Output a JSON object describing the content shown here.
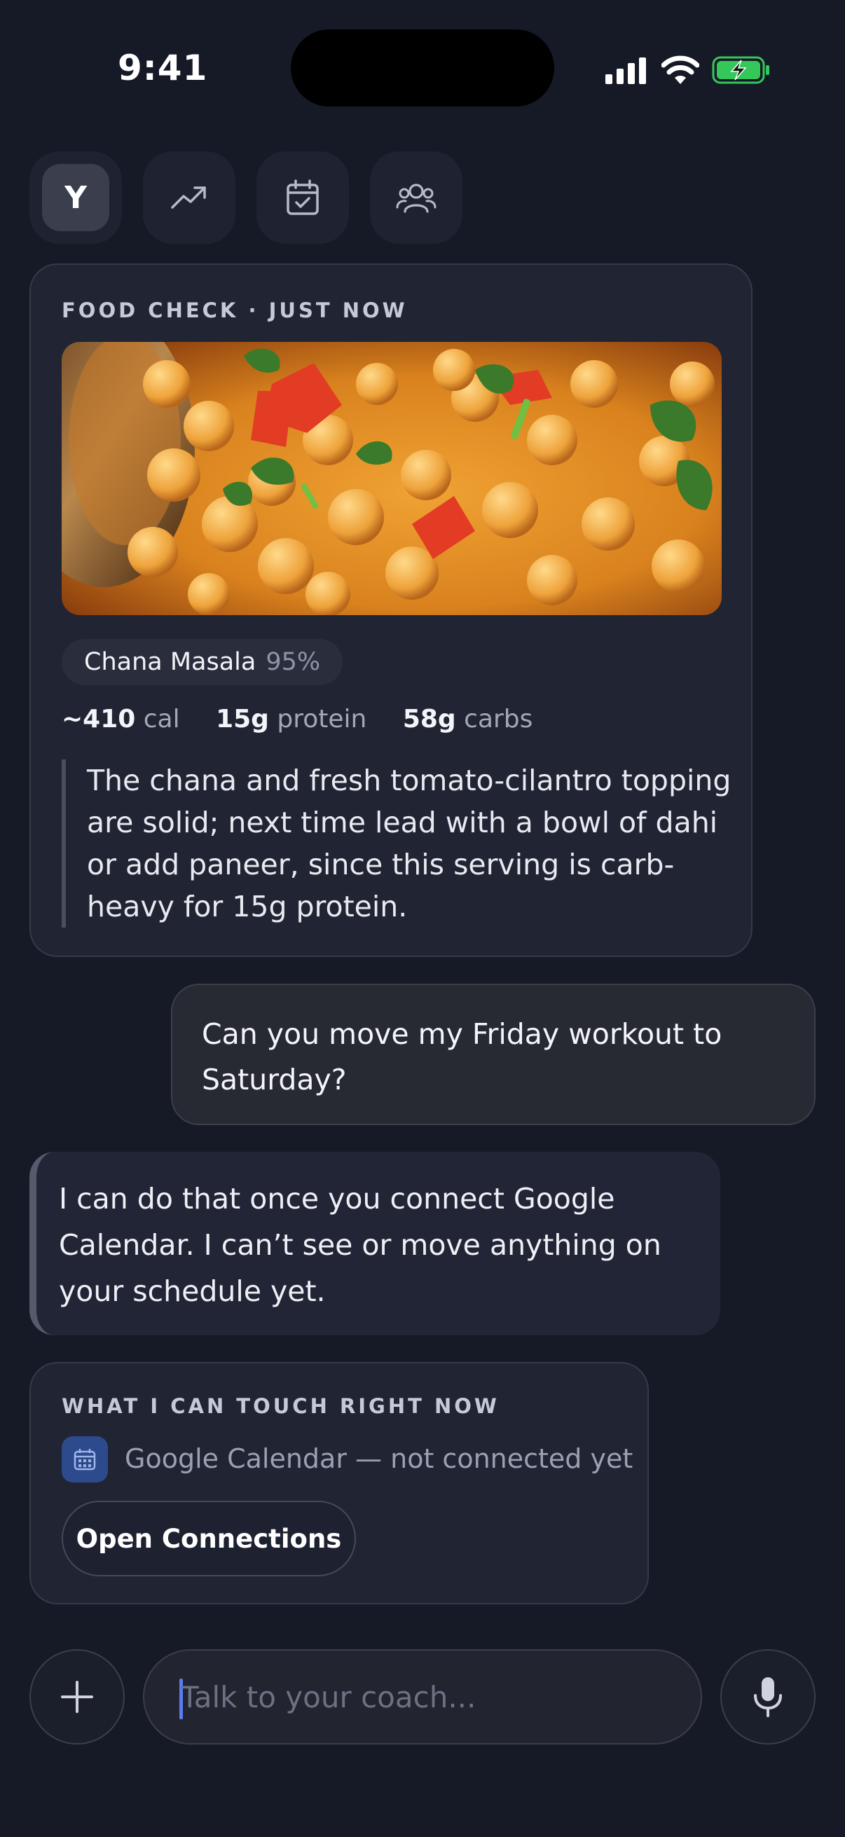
{
  "status_bar": {
    "time": "9:41"
  },
  "tabs": [
    {
      "name": "profile",
      "label": "Y",
      "active": true
    },
    {
      "name": "progress",
      "icon": "trending-up-icon"
    },
    {
      "name": "calendar",
      "icon": "calendar-check-icon"
    },
    {
      "name": "community",
      "icon": "users-icon"
    }
  ],
  "food_check": {
    "eyebrow": "FOOD CHECK · JUST NOW",
    "dish": "Chana Masala",
    "confidence": "95%",
    "calories_value": "~410",
    "calories_unit": "cal",
    "protein_value": "15g",
    "protein_unit": "protein",
    "carbs_value": "58g",
    "carbs_unit": "carbs",
    "feedback": "The chana and fresh tomato-cilantro topping are solid; next time lead with a bowl of dahi or add paneer, since this serving is carb-heavy for 15g protein."
  },
  "user_message": "Can you move my Friday workout to Saturday?",
  "coach_message": "I can do that once you connect Google Calendar. I can’t see or move anything on your schedule yet.",
  "capabilities": {
    "eyebrow": "WHAT I CAN TOUCH RIGHT NOW",
    "item_icon": "calendar-icon",
    "item_text": "Google Calendar — not connected yet",
    "button_label": "Open Connections"
  },
  "composer": {
    "placeholder": "Talk to your coach...",
    "add_icon": "plus-icon",
    "mic_icon": "microphone-icon"
  },
  "colors": {
    "background": "#161926",
    "card": "#212433",
    "accent_caret": "#5b7cf0",
    "calendar_icon_bg": "#2d4a8c",
    "battery_green": "#34c759"
  }
}
